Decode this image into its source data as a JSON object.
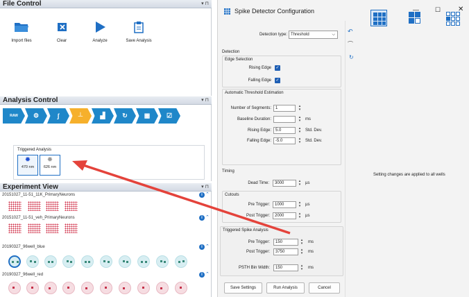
{
  "file_control": {
    "title": "File Control",
    "tools": [
      {
        "label": "Import files",
        "icon": "folder-icon"
      },
      {
        "label": "Clear",
        "icon": "clear-icon"
      },
      {
        "label": "Analyze",
        "icon": "play-icon"
      },
      {
        "label": "Save Analysis",
        "icon": "clipboard-icon"
      }
    ]
  },
  "analysis_control": {
    "title": "Analysis Control",
    "pipeline": [
      "RAW",
      "filter",
      "spike",
      "threshold",
      "burst",
      "cycle",
      "layout",
      "report"
    ],
    "triggered_title": "Triggered Analysis",
    "triggers": [
      {
        "label": "470 nm"
      },
      {
        "label": "626 nm"
      }
    ]
  },
  "experiment_view": {
    "title": "Experiment View",
    "experiments": [
      {
        "name": "20151027_11-51_11K_PrimaryNeurons"
      },
      {
        "name": "20151027_11-51_veh_PrimaryNeurons"
      },
      {
        "name": "20190327_96well_blue"
      },
      {
        "name": "20190327_96well_red"
      }
    ]
  },
  "dialog": {
    "title": "Spike Detector Configuration",
    "detection_type_label": "Detection type:",
    "detection_type_value": "Threshold",
    "detection_label": "Detection",
    "edge_selection": {
      "title": "Edge Selection",
      "rising": "Rising Edge",
      "falling": "Falling Edge"
    },
    "auto_threshold": {
      "title": "Automatic Threshold Estimation",
      "segments_label": "Number of Segments:",
      "segments_value": "1",
      "baseline_label": "Baseline Duration:",
      "baseline_value": "",
      "baseline_unit": "ms",
      "rising_label": "Rising Edge:",
      "rising_value": "5.0",
      "rising_unit": "Std. Dev.",
      "falling_label": "Falling Edge:",
      "falling_value": "-5.0",
      "falling_unit": "Std. Dev."
    },
    "timing": {
      "title": "Timing",
      "dead_label": "Dead Time:",
      "dead_value": "3000",
      "dead_unit": "µs"
    },
    "cutouts": {
      "title": "Cutouts",
      "pre_label": "Pre Trigger:",
      "pre_value": "1000",
      "pre_unit": "µs",
      "post_label": "Post Trigger:",
      "post_value": "2000",
      "post_unit": "µs"
    },
    "triggered_spike": {
      "title": "Triggered Spike Analysis",
      "pre_label": "Pre Trigger:",
      "pre_value": "150",
      "pre_unit": "ms",
      "post_label": "Post Trigger:",
      "post_value": "3750",
      "post_unit": "ms",
      "bin_label": "PSTH Bin Width:",
      "bin_value": "150",
      "bin_unit": "ms"
    },
    "buttons": {
      "save": "Save Settings",
      "run": "Run Analysis",
      "cancel": "Cancel"
    },
    "status": "Setting changes are applied to all wells",
    "window_controls": {
      "minimize": "—",
      "maximize": "☐",
      "close": "✕"
    }
  },
  "colors": {
    "accent": "#1f6fc4",
    "active_step": "#f6b02c",
    "arrow": "#e4433b"
  }
}
